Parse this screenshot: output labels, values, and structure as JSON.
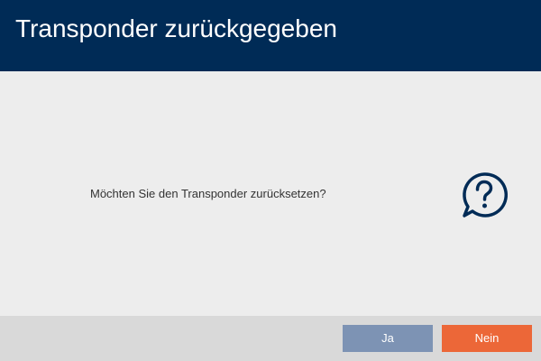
{
  "dialog": {
    "title": "Transponder zurückgegeben",
    "message": "Möchten Sie den Transponder zurücksetzen?",
    "icon": "question-bubble-icon",
    "buttons": {
      "yes_label": "Ja",
      "no_label": "Nein"
    }
  },
  "colors": {
    "title_bar": "#002b56",
    "yes_button": "#7d93b4",
    "no_button": "#ec6738",
    "icon": "#002b56"
  }
}
